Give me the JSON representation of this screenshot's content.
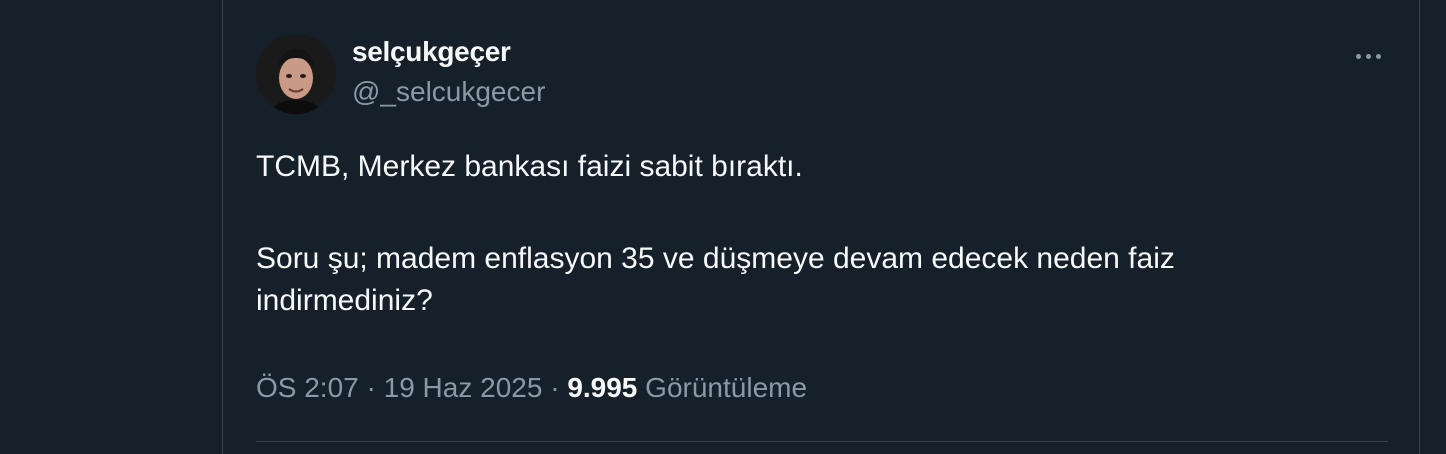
{
  "tweet": {
    "author": {
      "display_name": "selçukgeçer",
      "handle": "@_selcukgecer",
      "avatar_icon": "profile-photo"
    },
    "more_icon": "more-horizontal-icon",
    "text_lines": [
      "TCMB, Merkez bankası faizi sabit bıraktı.",
      "Soru şu; madem enflasyon 35 ve düşmeye devam edecek neden faiz",
      "indirmediniz?"
    ],
    "time": "ÖS 2:07",
    "separator": "·",
    "date": "19 Haz 2025",
    "views_count": "9.995",
    "views_label": "Görüntüleme"
  },
  "colors": {
    "background": "#15202b",
    "text_primary": "#f7f9f9",
    "text_secondary": "#8b98a5",
    "border": "#38444d"
  }
}
